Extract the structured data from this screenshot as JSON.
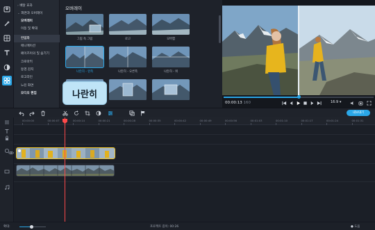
{
  "colors": {
    "accent": "#2aa7e8",
    "playhead": "#ff4a4a",
    "background": "#1b1f27",
    "clip_border": "#f2c21b"
  },
  "sidebar_tools": [
    {
      "name": "import-icon"
    },
    {
      "name": "magic-wand-icon"
    },
    {
      "name": "filters-icon"
    },
    {
      "name": "titles-icon"
    },
    {
      "name": "transitions-icon"
    },
    {
      "name": "more-tools-icon"
    }
  ],
  "category_menu": {
    "items": [
      {
        "label": "배달 효과",
        "kind": "parent"
      },
      {
        "label": "화면과 오버레이",
        "kind": "parent"
      },
      {
        "label": "오버레이",
        "kind": "sub",
        "bold": true
      },
      {
        "label": "이동 및 확대",
        "kind": "sub"
      },
      {
        "label": "컨템화",
        "kind": "sub",
        "selected": true
      },
      {
        "label": "애니메이션",
        "kind": "sub"
      },
      {
        "label": "페이즈이의 및 숨기기",
        "kind": "sub"
      },
      {
        "label": "크로마키",
        "kind": "sub"
      },
      {
        "label": "동영 감지",
        "kind": "sub"
      },
      {
        "label": "로고라인",
        "kind": "sub"
      },
      {
        "label": "느린 화면",
        "kind": "sub"
      },
      {
        "label": "오디오 편집",
        "kind": "sub",
        "bold": true
      }
    ]
  },
  "effects_panel": {
    "title": "오버레이",
    "items": [
      {
        "label": "그림 속 그림",
        "selected": false
      },
      {
        "label": "로고",
        "selected": false
      },
      {
        "label": "오버랩",
        "selected": false
      },
      {
        "label": "나란히 - 왼쪽",
        "selected": true
      },
      {
        "label": "나란히 - 오른쪽",
        "selected": false
      },
      {
        "label": "나란히 - 위",
        "selected": false
      },
      {
        "label": "",
        "selected": false
      },
      {
        "label": "",
        "selected": false
      },
      {
        "label": "",
        "selected": false
      }
    ],
    "tooltip": "나란히"
  },
  "preview": {
    "timecode": "00:00:13",
    "timecode_fraction": "160",
    "aspect_ratio": "16:9 ▾",
    "progress": 0.5
  },
  "toolbar": {
    "tools": [
      "undo-icon",
      "redo-icon",
      "delete-icon",
      "cut-icon",
      "rotate-icon",
      "crop-icon",
      "color-adjust-icon",
      "clip-properties-icon",
      "overlay-icon",
      "flag-icon"
    ],
    "export_label": "내보내기"
  },
  "timeline": {
    "ruler_ticks": [
      "00:00:00",
      "00:00:07",
      "00:00:14",
      "00:00:21",
      "00:00:28",
      "00:00:35",
      "00:00:42",
      "00:00:49",
      "00:00:56",
      "00:01:03",
      "00:01:10",
      "00:01:17",
      "00:01:24",
      "00:01:31"
    ],
    "playhead_time": "00:00:13"
  },
  "status": {
    "zoom_label": "확대:",
    "zoom_level": 0.45,
    "duration": "프로젝트 길이: 00:26",
    "help": "도움"
  }
}
